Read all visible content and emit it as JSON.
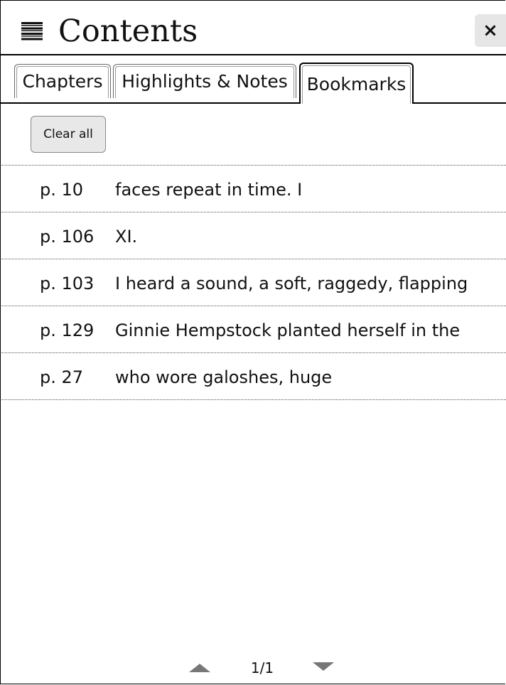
{
  "header": {
    "title": "Contents",
    "menu_icon": "list-icon",
    "close_label": "×"
  },
  "tabs": [
    {
      "label": "Chapters",
      "active": false
    },
    {
      "label": "Highlights & Notes",
      "active": false
    },
    {
      "label": "Bookmarks",
      "active": true
    }
  ],
  "clear_all_label": "Clear all",
  "bookmarks": [
    {
      "page": "p. 10",
      "text": "faces repeat in time. I"
    },
    {
      "page": "p. 106",
      "text": "XI."
    },
    {
      "page": "p. 103",
      "text": "I heard a sound, a soft, raggedy, flapping"
    },
    {
      "page": "p. 129",
      "text": "Ginnie Hempstock planted herself in the"
    },
    {
      "page": "p. 27",
      "text": "who wore galoshes, huge"
    }
  ],
  "pager": {
    "current": "1/1",
    "up_icon": "triangle-up-icon",
    "down_icon": "triangle-down-icon"
  }
}
